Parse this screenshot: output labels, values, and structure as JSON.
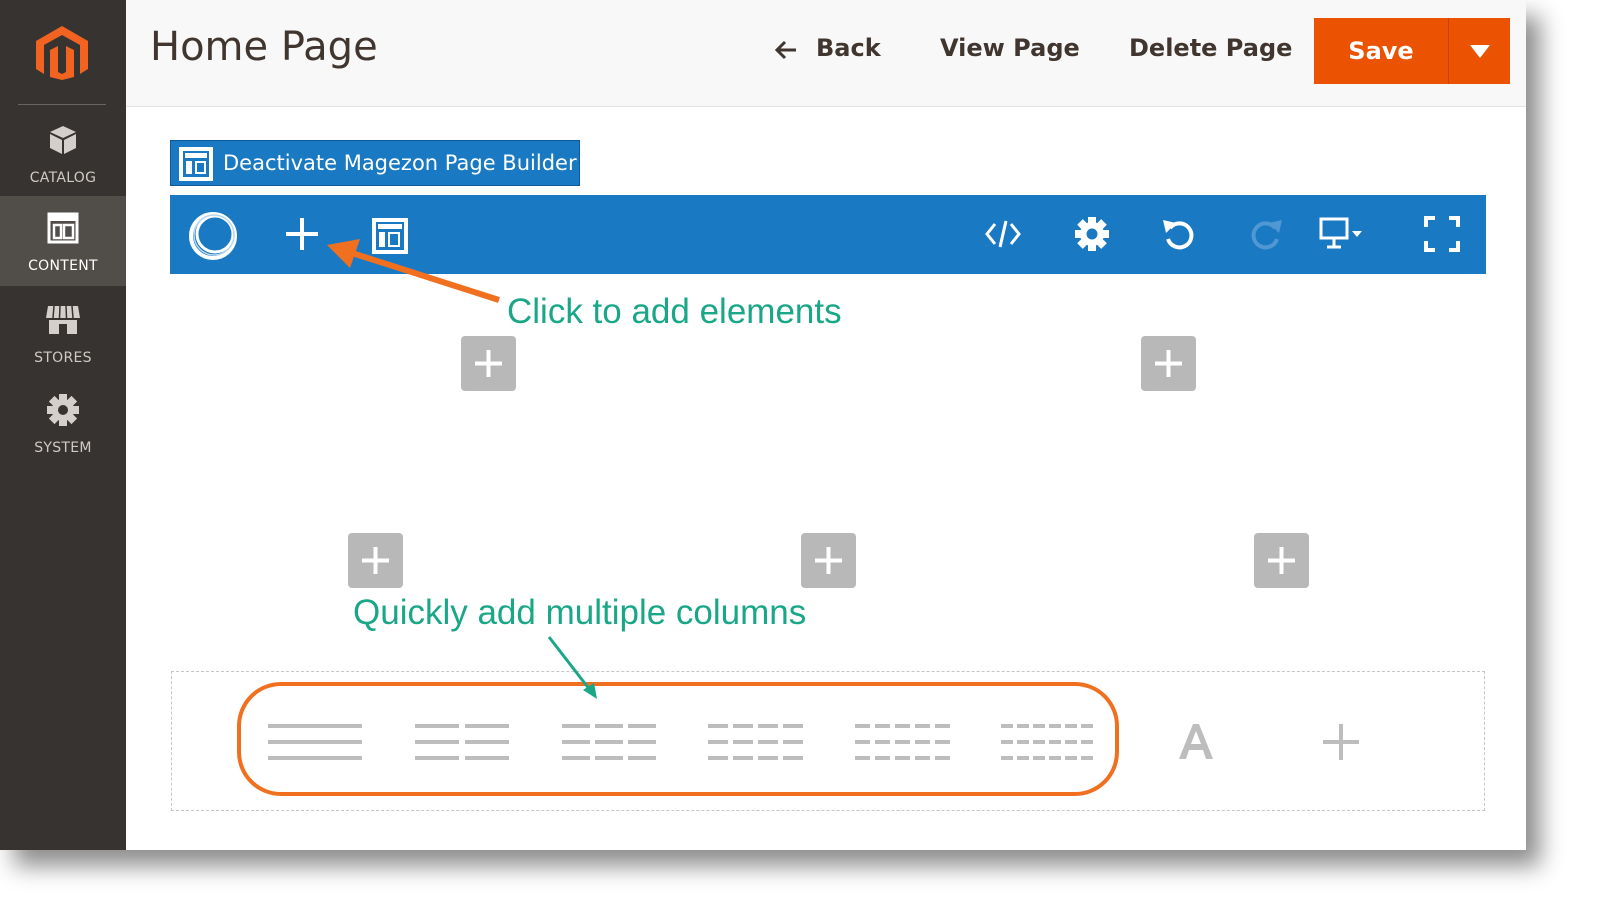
{
  "sidebar": {
    "logo": "magento-logo",
    "items": [
      {
        "label": "CATALOG",
        "icon": "cube-icon"
      },
      {
        "label": "CONTENT",
        "icon": "layout-icon",
        "active": true
      },
      {
        "label": "STORES",
        "icon": "storefront-icon"
      },
      {
        "label": "SYSTEM",
        "icon": "gear-icon"
      }
    ]
  },
  "header": {
    "title": "Home Page",
    "back_label": "Back",
    "view_label": "View Page",
    "delete_label": "Delete Page",
    "save_label": "Save"
  },
  "builder": {
    "deactivate_label": "Deactivate Magezon Page Builder",
    "toolbar": {
      "left": [
        "magezon-logo-icon",
        "plus-icon",
        "template-icon"
      ],
      "right": [
        "code-icon",
        "settings-gear-icon",
        "undo-icon",
        "redo-icon",
        "desktop-icon",
        "fullscreen-icon"
      ]
    }
  },
  "annotations": {
    "add_elements": "Click to add elements",
    "add_columns": "Quickly add multiple columns"
  },
  "column_options": [
    "1-column-icon",
    "2-columns-icon",
    "3-columns-icon",
    "4-columns-icon",
    "5-columns-icon",
    "6-columns-icon",
    "text-icon",
    "plus-icon"
  ],
  "colors": {
    "sidebar": "#373330",
    "accent_orange": "#eb5202",
    "toolbar_blue": "#1979c3",
    "annotation_green": "#1aa787"
  }
}
